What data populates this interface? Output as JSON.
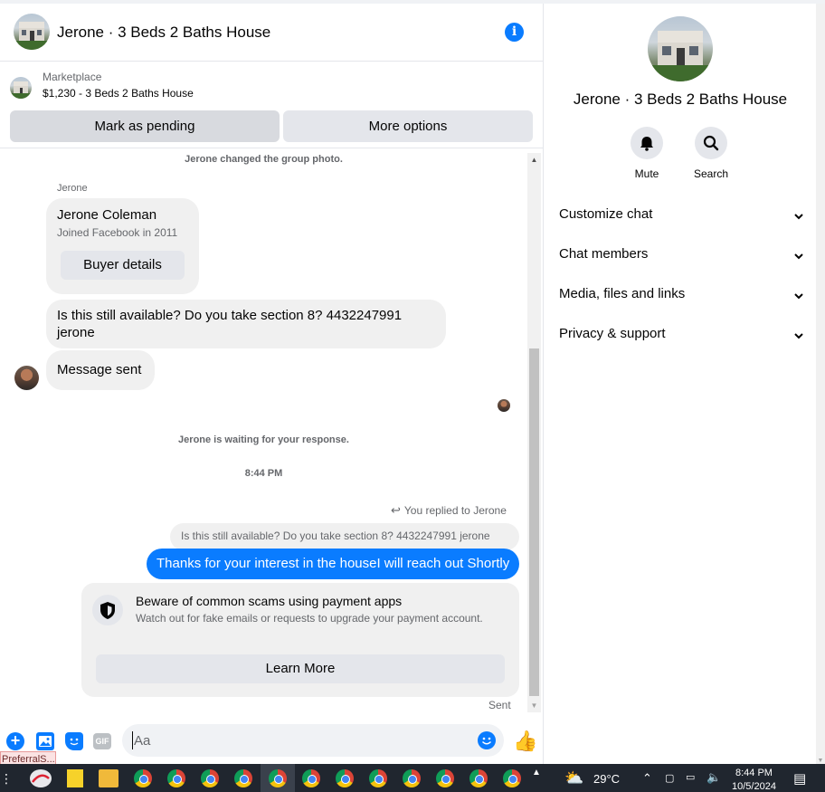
{
  "header": {
    "title": "Jerone · 3 Beds 2 Baths House"
  },
  "marketplace": {
    "label": "Marketplace",
    "item": "$1,230 - 3 Beds 2 Baths House",
    "mark_pending": "Mark as pending",
    "more_options": "More options"
  },
  "thread": {
    "group_photo_notice": "Jerone changed the group photo.",
    "sender_name": "Jerone",
    "buyer_card": {
      "name": "Jerone Coleman",
      "subtitle": "Joined Facebook in 2011",
      "button": "Buyer details"
    },
    "incoming_question": "Is this still available? Do you take section 8? 4432247991 jerone",
    "incoming_sent": "Message sent",
    "waiting_notice": "Jerone is waiting for your response.",
    "timestamp": "8:44 PM",
    "reply_label": "You replied to Jerone",
    "quoted_text": "Is this still available? Do you take section 8? 4432247991 jerone",
    "outgoing_message": "Thanks for your interest in the houseI will reach out Shortly",
    "scam_card": {
      "title": "Beware of common scams using payment apps",
      "body": "Watch out for fake emails or requests to upgrade your payment account.",
      "button": "Learn More"
    },
    "status": "Sent"
  },
  "composer": {
    "placeholder": "Aa",
    "gif_label": "GIF"
  },
  "tooltip": {
    "text": "PreferralS..."
  },
  "right_panel": {
    "title": "Jerone · 3 Beds 2 Baths House",
    "actions": [
      {
        "label": "Mute",
        "icon": "bell-icon"
      },
      {
        "label": "Search",
        "icon": "search-icon"
      }
    ],
    "sections": [
      {
        "label": "Customize chat"
      },
      {
        "label": "Chat members"
      },
      {
        "label": "Media, files and links"
      },
      {
        "label": "Privacy & support"
      }
    ]
  },
  "taskbar": {
    "weather": "29°C",
    "time": "8:44 PM",
    "date": "10/5/2024"
  },
  "colors": {
    "accent": "#0a7cff",
    "bubble_gray": "#f0f0f0",
    "button_gray": "#e4e6eb",
    "taskbar": "#20262f"
  }
}
